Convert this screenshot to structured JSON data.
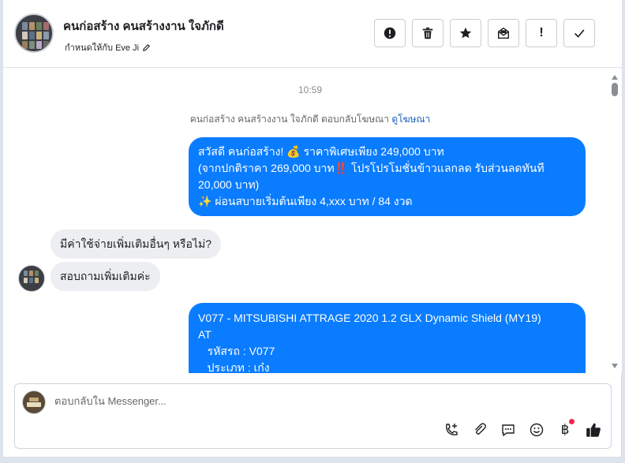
{
  "header": {
    "title": "คนก่อสร้าง คนสร้างงาน ใจภักดี",
    "assigned_label": "กำหนดให้กับ Eve Ji",
    "actions": [
      {
        "name": "report-button",
        "icon": "alert-circle-icon"
      },
      {
        "name": "delete-button",
        "icon": "trash-icon"
      },
      {
        "name": "star-button",
        "icon": "star-icon"
      },
      {
        "name": "mark-unread-button",
        "icon": "envelope-icon"
      },
      {
        "name": "priority-button",
        "icon": "exclamation-icon",
        "glyph": "!"
      },
      {
        "name": "done-button",
        "icon": "check-icon"
      }
    ]
  },
  "thread": {
    "timestamp": "10:59",
    "ad_note_prefix": "คนก่อสร้าง คนสร้างงาน ใจภักดี ตอบกลับโฆษณา",
    "ad_note_link": "ดูโฆษณา",
    "messages": [
      {
        "direction": "out",
        "lines": [
          "สวัสดี คนก่อสร้าง! 💰 ราคาพิเศษเพียง 249,000 บาท",
          "(จากปกติราคา 269,000 บาท‼️ โปรโปรโมชั่นข้าวแลกลด รับส่วนลดทันที",
          "20,000 บาท)",
          "✨ ผ่อนสบายเริ่มต้นเพียง 4,xxx บาท / 84 งวด"
        ]
      },
      {
        "direction": "in",
        "lines": [
          "มีค่าใช้จ่ายเพิ่มเติมอื่นๆ หรือไม่?"
        ]
      },
      {
        "direction": "in",
        "lines": [
          "สอบถามเพิ่มเติมค่ะ"
        ]
      },
      {
        "direction": "out",
        "lines": [
          "V077 - MITSUBISHI ATTRAGE 2020 1.2 GLX Dynamic Shield (MY19)",
          "AT",
          "   รหัสรถ : V077",
          "   ประเภท : เก๋ง"
        ]
      }
    ]
  },
  "composer": {
    "placeholder": "ตอบกลับใน Messenger...",
    "baht_glyph": "฿",
    "icons": [
      "call-add-icon",
      "attachment-icon",
      "saved-reply-icon",
      "emoji-icon",
      "payment-icon",
      "like-icon"
    ]
  },
  "colors": {
    "accent": "#0a7cff",
    "incoming_bubble": "#eceef1",
    "link": "#1b5fb8",
    "notification_dot": "#f0284a"
  }
}
